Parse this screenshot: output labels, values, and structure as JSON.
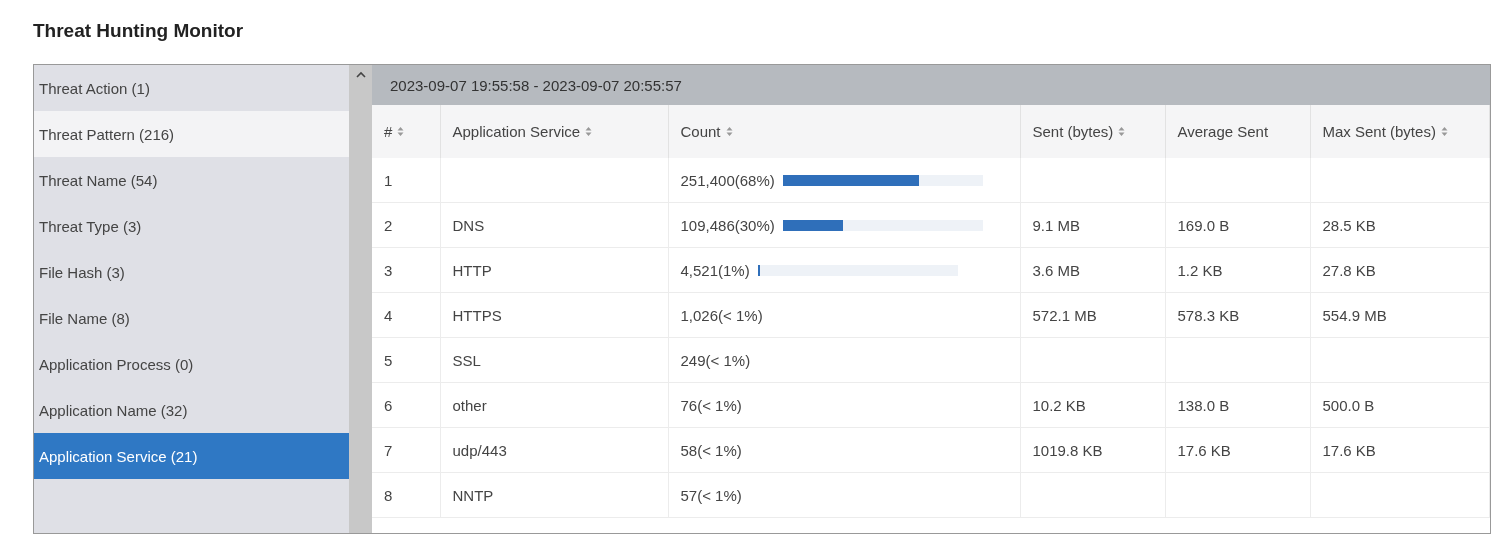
{
  "title": "Threat Hunting Monitor",
  "sidebar": {
    "items": [
      {
        "label": "Threat Action (1)",
        "selected": false,
        "highlighted": false
      },
      {
        "label": "Threat Pattern (216)",
        "selected": false,
        "highlighted": true
      },
      {
        "label": "Threat Name (54)",
        "selected": false,
        "highlighted": false
      },
      {
        "label": "Threat Type (3)",
        "selected": false,
        "highlighted": false
      },
      {
        "label": "File Hash (3)",
        "selected": false,
        "highlighted": false
      },
      {
        "label": "File Name (8)",
        "selected": false,
        "highlighted": false
      },
      {
        "label": "Application Process (0)",
        "selected": false,
        "highlighted": false
      },
      {
        "label": "Application Name (32)",
        "selected": false,
        "highlighted": false
      },
      {
        "label": "Application Service (21)",
        "selected": true,
        "highlighted": false
      }
    ]
  },
  "table": {
    "time_range": "2023-09-07 19:55:58 - 2023-09-07 20:55:57",
    "columns": [
      {
        "label": "#",
        "sortable": true
      },
      {
        "label": "Application Service",
        "sortable": true
      },
      {
        "label": "Count",
        "sortable": true
      },
      {
        "label": "Sent (bytes)",
        "sortable": true
      },
      {
        "label": "Average Sent",
        "sortable": false
      },
      {
        "label": "Max Sent (bytes)",
        "sortable": true
      }
    ],
    "rows": [
      {
        "index": "1",
        "service": "",
        "count": "251,400(68%)",
        "level": 0.68,
        "sent": "",
        "average_sent": "",
        "max_sent": ""
      },
      {
        "index": "2",
        "service": "DNS",
        "count": "109,486(30%)",
        "level": 0.3,
        "sent": "9.1 MB",
        "average_sent": "169.0 B",
        "max_sent": "28.5 KB"
      },
      {
        "index": "3",
        "service": "HTTP",
        "count": "4,521(1%)",
        "level": 0.01,
        "sent": "3.6 MB",
        "average_sent": "1.2 KB",
        "max_sent": "27.8 KB"
      },
      {
        "index": "4",
        "service": "HTTPS",
        "count": "1,026(< 1%)",
        "sent": "572.1 MB",
        "average_sent": "578.3 KB",
        "max_sent": "554.9 MB"
      },
      {
        "index": "5",
        "service": "SSL",
        "count": "249(< 1%)",
        "sent": "",
        "average_sent": "",
        "max_sent": ""
      },
      {
        "index": "6",
        "service": "other",
        "count": "76(< 1%)",
        "sent": "10.2 KB",
        "average_sent": "138.0 B",
        "max_sent": "500.0 B"
      },
      {
        "index": "7",
        "service": "udp/443",
        "count": "58(< 1%)",
        "sent": "1019.8 KB",
        "average_sent": "17.6 KB",
        "max_sent": "17.6 KB"
      },
      {
        "index": "8",
        "service": "NNTP",
        "count": "57(< 1%)",
        "sent": "",
        "average_sent": "",
        "max_sent": ""
      }
    ]
  }
}
